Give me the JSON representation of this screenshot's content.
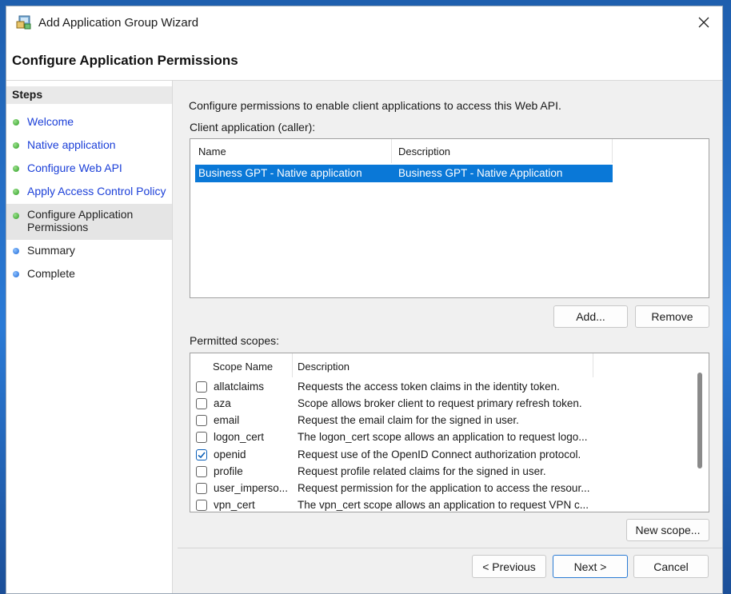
{
  "window": {
    "title": "Add Application Group Wizard",
    "header": "Configure Application Permissions"
  },
  "steps": {
    "heading": "Steps",
    "items": [
      {
        "label": "Welcome",
        "state": "done"
      },
      {
        "label": "Native application",
        "state": "done"
      },
      {
        "label": "Configure Web API",
        "state": "done"
      },
      {
        "label": "Apply Access Control Policy",
        "state": "done"
      },
      {
        "label": "Configure Application Permissions",
        "state": "current"
      },
      {
        "label": "Summary",
        "state": "pending"
      },
      {
        "label": "Complete",
        "state": "pending"
      }
    ]
  },
  "main": {
    "intro": "Configure permissions to enable client applications to access this Web API.",
    "client_label": "Client application (caller):",
    "client_columns": [
      "Name",
      "Description"
    ],
    "client_rows": [
      {
        "name": "Business GPT - Native application",
        "description": "Business GPT - Native Application"
      }
    ],
    "add_button": "Add...",
    "remove_button": "Remove",
    "scopes_label": "Permitted scopes:",
    "scope_columns": [
      "Scope Name",
      "Description"
    ],
    "scopes": [
      {
        "name": "allatclaims",
        "description": "Requests the access token claims in the identity token.",
        "checked": false
      },
      {
        "name": "aza",
        "description": "Scope allows broker client to request primary refresh token.",
        "checked": false
      },
      {
        "name": "email",
        "description": "Request the email claim for the signed in user.",
        "checked": false
      },
      {
        "name": "logon_cert",
        "description": "The logon_cert scope allows an application to request logo...",
        "checked": false
      },
      {
        "name": "openid",
        "description": "Request use of the OpenID Connect authorization protocol.",
        "checked": true
      },
      {
        "name": "profile",
        "description": "Request profile related claims for the signed in user.",
        "checked": false
      },
      {
        "name": "user_imperso...",
        "description": "Request permission for the application to access the resour...",
        "checked": false
      },
      {
        "name": "vpn_cert",
        "description": "The vpn_cert scope allows an application to request VPN c...",
        "checked": false
      }
    ],
    "new_scope_button": "New scope..."
  },
  "footer": {
    "previous": "< Previous",
    "next": "Next >",
    "cancel": "Cancel"
  },
  "colors": {
    "selection": "#0a78d7",
    "link": "#1b3fd8",
    "done_dot": "#2e9f24",
    "pending_dot": "#1a67d6"
  }
}
